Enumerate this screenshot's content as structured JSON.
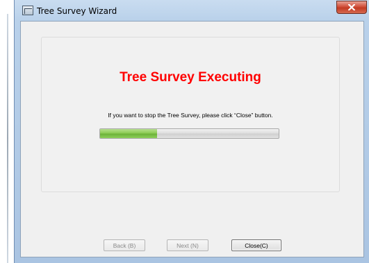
{
  "window": {
    "title": "Tree Survey Wizard",
    "close_icon": "close-x-icon",
    "app_icon": "wizard-window-icon"
  },
  "panel": {
    "heading": "Tree Survey Executing",
    "heading_color": "#ff0000",
    "message": "If you want to stop the Tree Survey, please click “Close” button."
  },
  "progress": {
    "value": 0.32,
    "fill_color": "#8ccb55"
  },
  "buttons": {
    "back_label": "Back (B)",
    "back_enabled": false,
    "next_label": "Next (N)",
    "next_enabled": false,
    "close_label": "Close(C)",
    "close_enabled": true
  }
}
